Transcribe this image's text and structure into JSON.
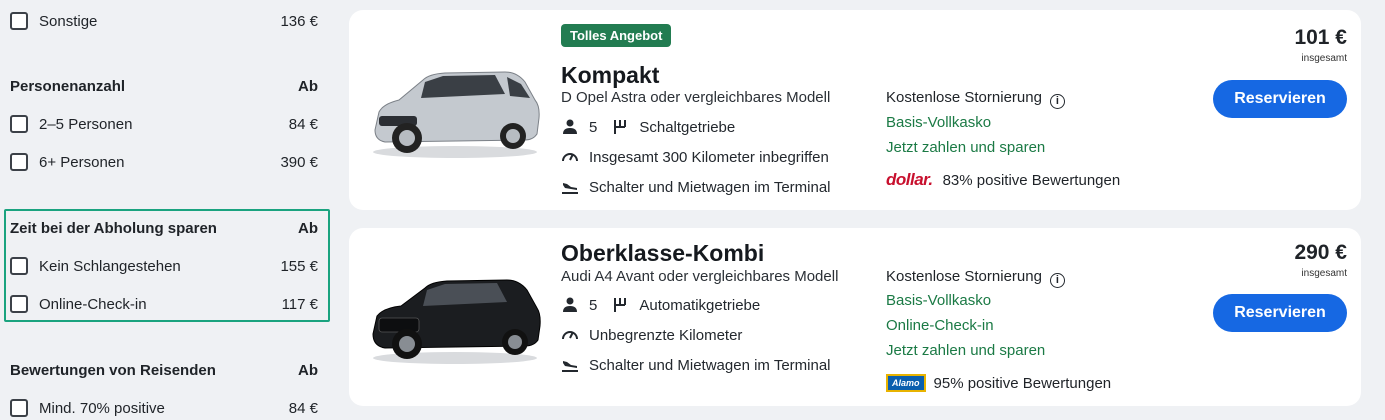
{
  "filters": {
    "sonstige": {
      "label": "Sonstige",
      "price": "136 €"
    },
    "personen": {
      "title": "Personenanzahl",
      "ab": "Ab",
      "items": [
        {
          "label": "2–5 Personen",
          "price": "84 €"
        },
        {
          "label": "6+ Personen",
          "price": "390 €"
        }
      ]
    },
    "zeit": {
      "title": "Zeit bei der Abholung sparen",
      "ab": "Ab",
      "items": [
        {
          "label": "Kein Schlangestehen",
          "price": "155 €"
        },
        {
          "label": "Online-Check-in",
          "price": "117 €"
        }
      ]
    },
    "bewertungen": {
      "title": "Bewertungen von Reisenden",
      "ab": "Ab",
      "items": [
        {
          "label": "Mind. 70% positive",
          "price": "84 €"
        }
      ]
    }
  },
  "cards": [
    {
      "badge": "Tolles Angebot",
      "title": "Kompakt",
      "model": "D Opel Astra oder vergleichbares Modell",
      "seats": "5",
      "transmission": "Schaltgetriebe",
      "mileage": "Insgesamt 300 Kilometer inbegriffen",
      "pickup": "Schalter und Mietwagen im Terminal",
      "cancel": "Kostenlose Stornierung",
      "info_icon": "i",
      "perks": [
        "Basis-Vollkasko",
        "Jetzt zahlen und sparen"
      ],
      "vendor_logo": "dollar.",
      "rating": "83% positive Bewertungen",
      "price": "101 €",
      "price_sub": "insgesamt",
      "button": "Reservieren",
      "car_color": "#c4c9cf"
    },
    {
      "title": "Oberklasse-Kombi",
      "model": "Audi A4 Avant oder vergleichbares Modell",
      "seats": "5",
      "transmission": "Automatikgetriebe",
      "mileage": "Unbegrenzte Kilometer",
      "pickup": "Schalter und Mietwagen im Terminal",
      "cancel": "Kostenlose Stornierung",
      "info_icon": "i",
      "perks": [
        "Basis-Vollkasko",
        "Online-Check-in",
        "Jetzt zahlen und sparen"
      ],
      "vendor_logo": "Alamo",
      "rating": "95% positive Bewertungen",
      "price": "290 €",
      "price_sub": "insgesamt",
      "button": "Reservieren",
      "car_color": "#1b1d20"
    }
  ]
}
